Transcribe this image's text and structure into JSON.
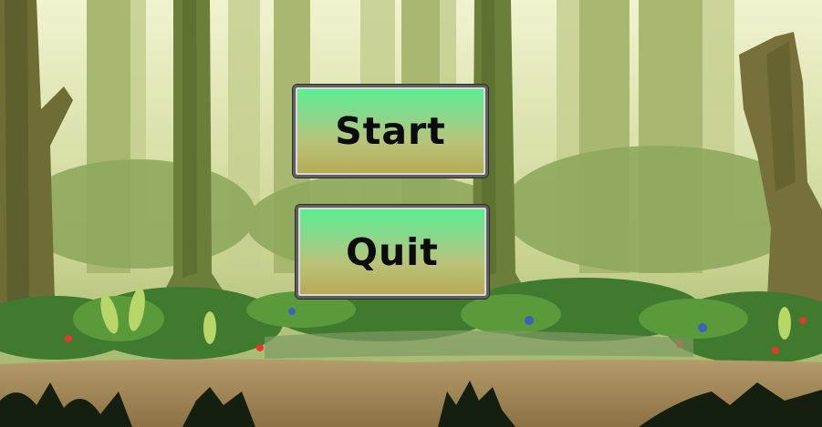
{
  "menu": {
    "start_label": "Start",
    "quit_label": "Quit"
  },
  "colors": {
    "button_top": "#5cf08f",
    "button_bottom": "#b7a955",
    "button_text": "#0b0b0b",
    "sky": "#e9eebf",
    "ground": "#9c8456"
  }
}
